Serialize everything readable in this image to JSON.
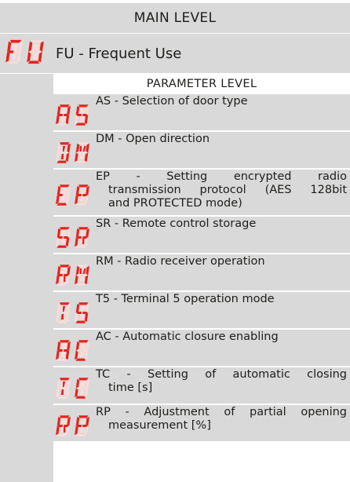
{
  "main_level": {
    "title": "MAIN LEVEL"
  },
  "fu": {
    "code": "FU",
    "label": "FU - Frequent Use"
  },
  "parameter_level": {
    "title": "PARAMETER LEVEL"
  },
  "parameters": [
    {
      "code": "AS",
      "lines": [
        "AS - Selection of door type"
      ]
    },
    {
      "code": "DM",
      "lines": [
        "DM - Open direction"
      ]
    },
    {
      "code": "EP",
      "lines": [
        "EP - Setting encrypted radio",
        "transmission protocol (AES 128bit",
        "and PROTECTED mode)"
      ]
    },
    {
      "code": "SR",
      "lines": [
        "SR - Remote control storage"
      ]
    },
    {
      "code": "RM",
      "lines": [
        "RM - Radio receiver operation"
      ]
    },
    {
      "code": "T5",
      "lines": [
        "T5 - Terminal 5 operation mode"
      ]
    },
    {
      "code": "AC",
      "lines": [
        "AC - Automatic closure enabling"
      ]
    },
    {
      "code": "TC",
      "lines": [
        "TC - Setting of automatic closing",
        "time [s]"
      ]
    },
    {
      "code": "RP",
      "lines": [
        "RP - Adjustment of partial opening",
        "measurement [%]"
      ]
    }
  ],
  "colors": {
    "segment_on": "#e6221b",
    "segment_off": "#f7dcd9",
    "band": "#d9d9d9"
  }
}
